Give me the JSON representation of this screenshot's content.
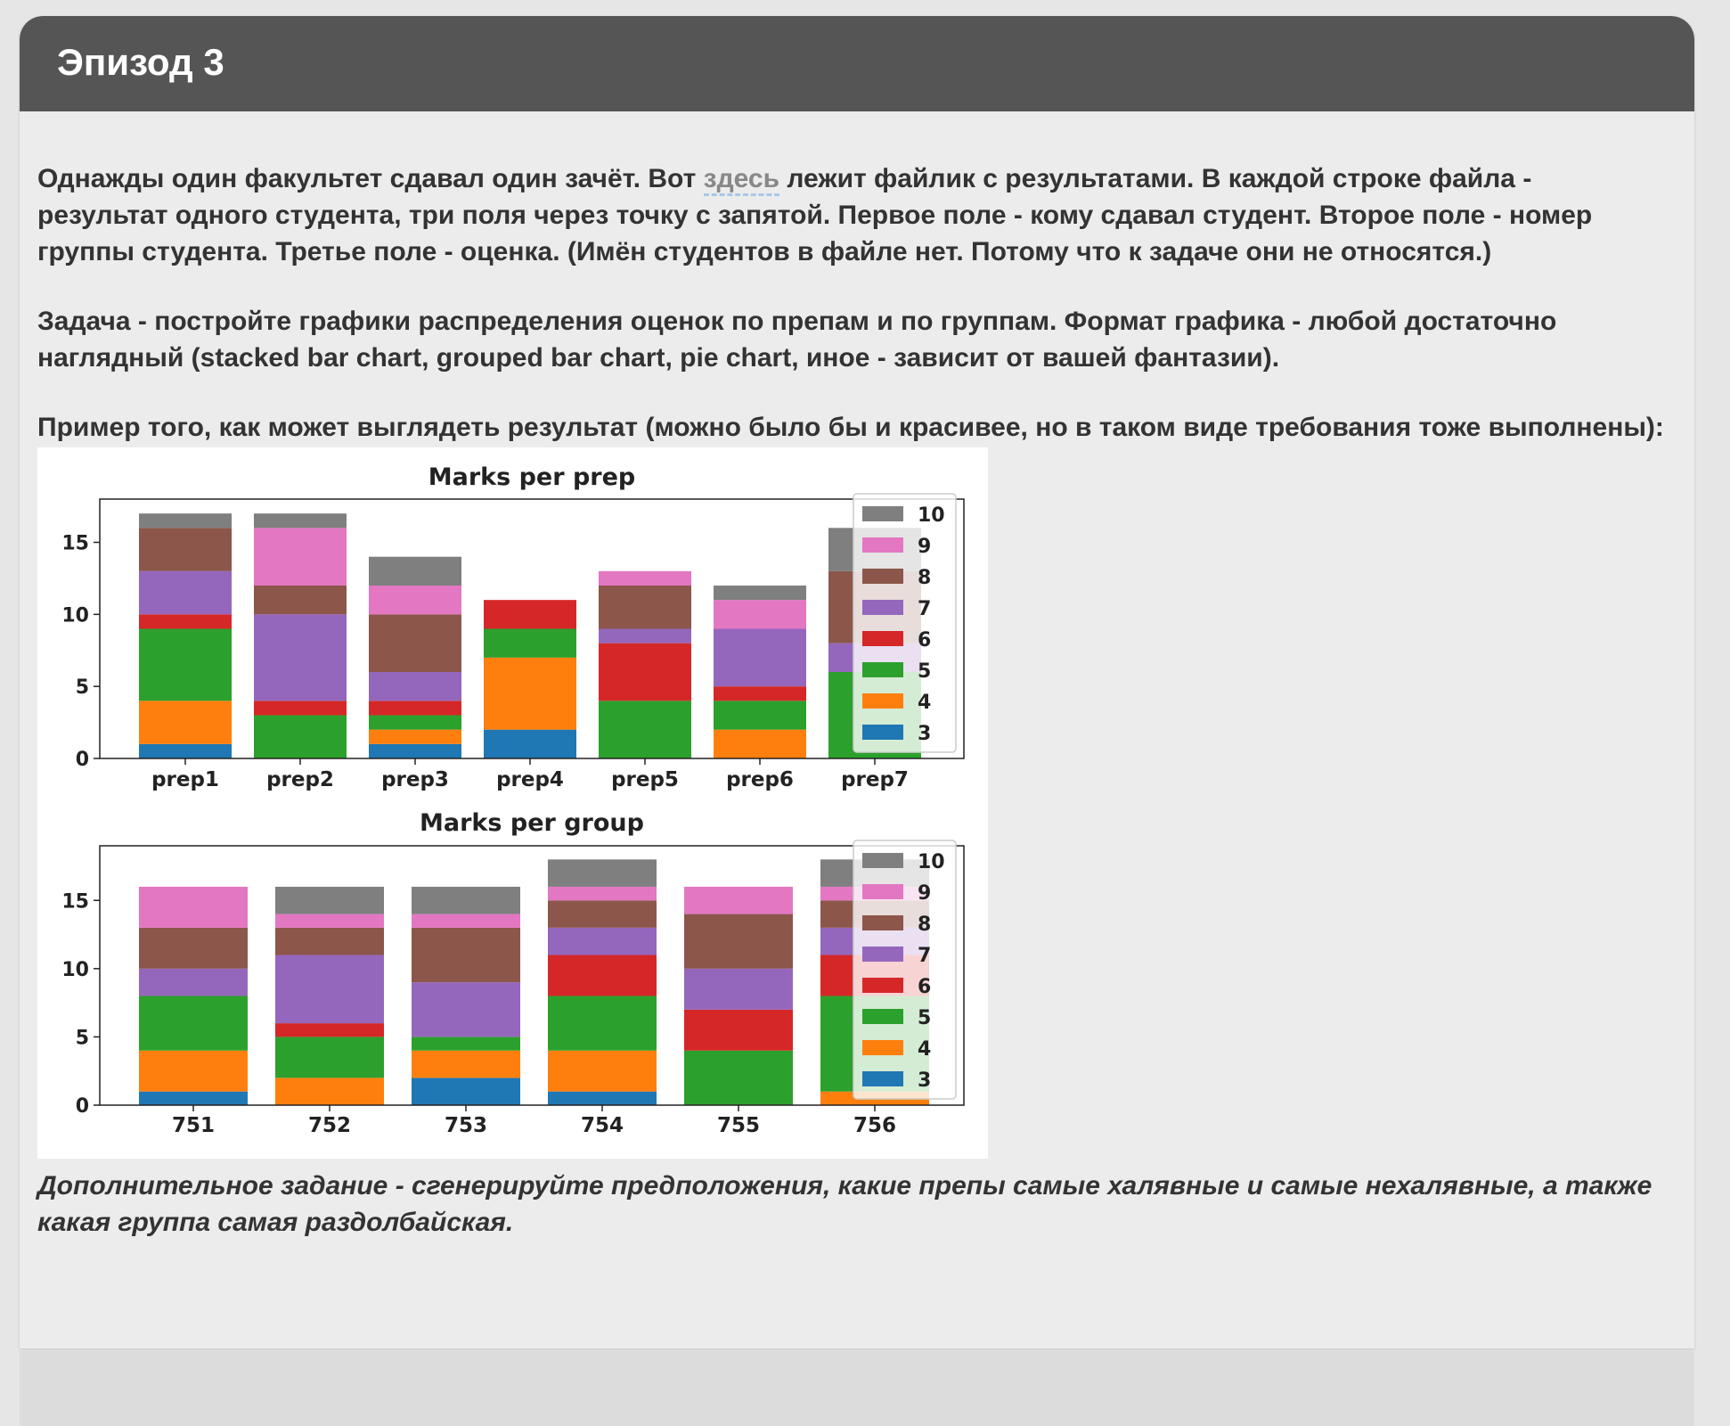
{
  "episode": {
    "title": "Эпизод 3"
  },
  "intro": {
    "before_link": "Однажды один факультет сдавал один зачёт. Вот ",
    "link_text": "здесь",
    "after_link": " лежит файлик с результатами. В каждой строке файла - результат одного студента, три поля через точку с запятой. Первое поле - кому сдавал студент. Второе поле - номер группы студента. Третье поле - оценка. (Имён студентов в файле нет. Потому что к задаче они не относятся.)"
  },
  "task": "Задача - постройте графики распределения оценок по препам и по группам. Формат графика - любой достаточно наглядный (stacked bar chart, grouped bar chart, pie chart, иное - зависит от вашей фантазии).",
  "example_caption": "Пример того, как может выглядеть результат (можно было бы и красивее, но в таком виде требования тоже выполнены):",
  "extra_task": "Дополнительное задание - сгенерируйте предположения, какие препы самые халявные и самые нехалявные, а также какая группа самая раздолбайская.",
  "chart_data": [
    {
      "type": "bar",
      "stacked": true,
      "title": "Marks per prep",
      "categories": [
        "prep1",
        "prep2",
        "prep3",
        "prep4",
        "prep5",
        "prep6",
        "prep7"
      ],
      "ylim": [
        0,
        18
      ],
      "yticks": [
        0,
        5,
        10,
        15
      ],
      "legend_position": "upper right",
      "series": [
        {
          "name": "3",
          "color": "#1f77b4",
          "values": [
            1,
            0,
            1,
            2,
            0,
            0,
            0
          ]
        },
        {
          "name": "4",
          "color": "#ff7f0e",
          "values": [
            3,
            0,
            1,
            5,
            0,
            2,
            0
          ]
        },
        {
          "name": "5",
          "color": "#2ca02c",
          "values": [
            5,
            3,
            1,
            2,
            4,
            2,
            6
          ]
        },
        {
          "name": "6",
          "color": "#d62728",
          "values": [
            1,
            1,
            1,
            2,
            4,
            1,
            0
          ]
        },
        {
          "name": "7",
          "color": "#9467bd",
          "values": [
            3,
            6,
            2,
            0,
            1,
            4,
            2
          ]
        },
        {
          "name": "8",
          "color": "#8c564b",
          "values": [
            3,
            2,
            4,
            0,
            3,
            0,
            5
          ]
        },
        {
          "name": "9",
          "color": "#e377c2",
          "values": [
            0,
            4,
            2,
            0,
            1,
            2,
            0
          ]
        },
        {
          "name": "10",
          "color": "#7f7f7f",
          "values": [
            1,
            1,
            2,
            0,
            0,
            1,
            3
          ]
        }
      ]
    },
    {
      "type": "bar",
      "stacked": true,
      "title": "Marks per group",
      "categories": [
        "751",
        "752",
        "753",
        "754",
        "755",
        "756"
      ],
      "ylim": [
        0,
        19
      ],
      "yticks": [
        0,
        5,
        10,
        15
      ],
      "legend_position": "upper right",
      "series": [
        {
          "name": "3",
          "color": "#1f77b4",
          "values": [
            1,
            0,
            2,
            1,
            0,
            0
          ]
        },
        {
          "name": "4",
          "color": "#ff7f0e",
          "values": [
            3,
            2,
            2,
            3,
            0,
            1
          ]
        },
        {
          "name": "5",
          "color": "#2ca02c",
          "values": [
            4,
            3,
            1,
            4,
            4,
            7
          ]
        },
        {
          "name": "6",
          "color": "#d62728",
          "values": [
            0,
            1,
            0,
            3,
            3,
            3
          ]
        },
        {
          "name": "7",
          "color": "#9467bd",
          "values": [
            2,
            5,
            4,
            2,
            3,
            2
          ]
        },
        {
          "name": "8",
          "color": "#8c564b",
          "values": [
            3,
            2,
            4,
            2,
            4,
            2
          ]
        },
        {
          "name": "9",
          "color": "#e377c2",
          "values": [
            3,
            1,
            1,
            1,
            2,
            1
          ]
        },
        {
          "name": "10",
          "color": "#7f7f7f",
          "values": [
            0,
            2,
            2,
            2,
            0,
            2
          ]
        }
      ]
    }
  ]
}
